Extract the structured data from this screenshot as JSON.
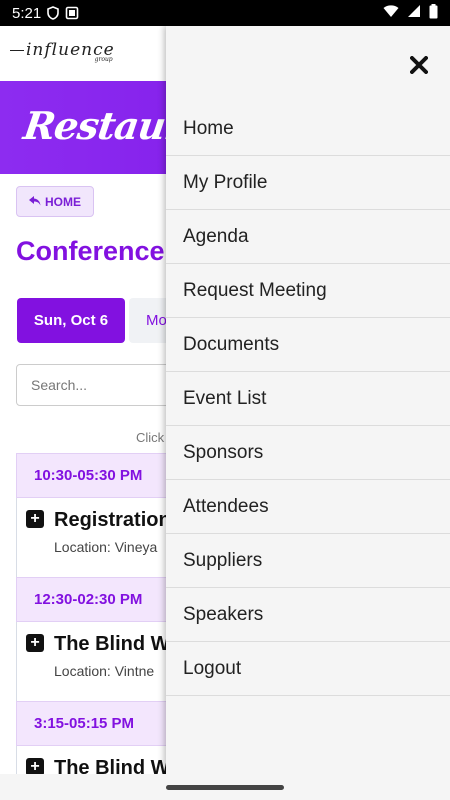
{
  "status_bar": {
    "time": "5:21",
    "icons_left": [
      "shield-icon",
      "screenshot-icon"
    ],
    "icons_right": [
      "wifi-icon",
      "signal-icon",
      "battery-icon"
    ]
  },
  "header": {
    "logo_text": "influence",
    "logo_sub": "group"
  },
  "banner": {
    "title": "RestaurantSpa"
  },
  "home_button": {
    "label": "HOME",
    "icon": "reply-arrow-icon"
  },
  "page": {
    "title": "Conference"
  },
  "date_tabs": [
    {
      "label": "Sun, Oct 6",
      "active": true
    },
    {
      "label": "Mo",
      "active": false
    }
  ],
  "search": {
    "placeholder": "Search..."
  },
  "hint": "Click",
  "schedule": [
    {
      "time": "10:30-05:30 PM",
      "title": "Registration",
      "location": "Location: Vineya"
    },
    {
      "time": "12:30-02:30 PM",
      "title": "The Blind W",
      "location": "Location: Vintne"
    },
    {
      "time": "3:15-05:15 PM",
      "title": "The Blind W",
      "location": ""
    }
  ],
  "drawer": {
    "close_icon": "close-icon",
    "items": [
      "Home",
      "My Profile",
      "Agenda",
      "Request Meeting",
      "Documents",
      "Event List",
      "Sponsors",
      "Attendees",
      "Suppliers",
      "Speakers",
      "Logout"
    ]
  },
  "colors": {
    "accent": "#8211e0",
    "banner": "#8d2cf0",
    "time_header_bg": "#f3e6fd",
    "drawer_bg": "#f5f5f5"
  }
}
